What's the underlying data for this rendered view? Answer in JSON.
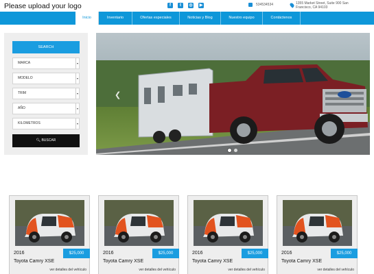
{
  "header": {
    "logo_text": "Please upload your logo",
    "socials": [
      {
        "icon": "facebook-icon",
        "glyph": "f"
      },
      {
        "icon": "twitter-icon",
        "glyph": "t"
      },
      {
        "icon": "instagram-icon",
        "glyph": "◎"
      },
      {
        "icon": "youtube-icon",
        "glyph": "▶"
      }
    ],
    "phone": "534534534",
    "address": "1355 Market Street, Suite 900 San Francisco, CA 94103",
    "accent_color": "#0e97d9"
  },
  "nav": {
    "items": [
      {
        "label": "Inicio"
      },
      {
        "label": "Inventario"
      },
      {
        "label": "Ofertas especiales"
      },
      {
        "label": "Noticias y Blog"
      },
      {
        "label": "Nuestro equipo"
      },
      {
        "label": "Contáctenos"
      }
    ]
  },
  "search": {
    "title": "SEARCH",
    "fields": [
      {
        "label": "MARCA"
      },
      {
        "label": "MODELO"
      },
      {
        "label": "TRIM"
      },
      {
        "label": "AÑO"
      },
      {
        "label": "KILOMETROS"
      }
    ],
    "button_label": "BUSCAR"
  },
  "hero": {
    "prev_icon": "chevron-left-icon",
    "slide_count": 2,
    "active_slide": 1
  },
  "cards": [
    {
      "year": "2016",
      "price": "$25,000",
      "title": "Toyota Camry XSE",
      "link": "ver detalles del vehículo"
    },
    {
      "year": "2016",
      "price": "$25,000",
      "title": "Toyota Camry XSE",
      "link": "ver detalles del vehículo"
    },
    {
      "year": "2016",
      "price": "$25,000",
      "title": "Toyota Camry XSE",
      "link": "ver detalles del vehículo"
    },
    {
      "year": "2016",
      "price": "$25,000",
      "title": "Toyota Camry XSE",
      "link": "ver detalles del vehículo"
    }
  ]
}
